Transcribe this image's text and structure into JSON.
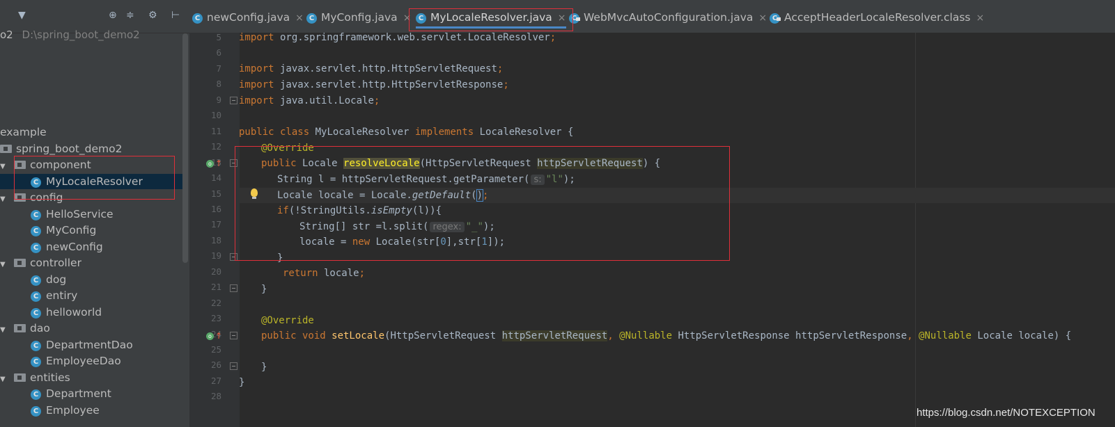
{
  "project": {
    "root_name": "o2",
    "root_path": "D:\\spring_boot_demo2"
  },
  "tree": [
    {
      "label": "example",
      "kind": "text",
      "indent": 0
    },
    {
      "label": "spring_boot_demo2",
      "kind": "folder",
      "indent": 0
    },
    {
      "label": "component",
      "kind": "folder",
      "indent": 1,
      "expanded": true
    },
    {
      "label": "MyLocaleResolver",
      "kind": "class",
      "indent": 2,
      "selected": true
    },
    {
      "label": "config",
      "kind": "folder",
      "indent": 1,
      "expanded": true
    },
    {
      "label": "HelloService",
      "kind": "class",
      "indent": 2
    },
    {
      "label": "MyConfig",
      "kind": "class",
      "indent": 2
    },
    {
      "label": "newConfig",
      "kind": "class",
      "indent": 2
    },
    {
      "label": "controller",
      "kind": "folder",
      "indent": 1,
      "expanded": true
    },
    {
      "label": "dog",
      "kind": "class",
      "indent": 2
    },
    {
      "label": "entiry",
      "kind": "class",
      "indent": 2
    },
    {
      "label": "helloworld",
      "kind": "class",
      "indent": 2
    },
    {
      "label": "dao",
      "kind": "folder",
      "indent": 1,
      "expanded": true
    },
    {
      "label": "DepartmentDao",
      "kind": "class",
      "indent": 2
    },
    {
      "label": "EmployeeDao",
      "kind": "class",
      "indent": 2
    },
    {
      "label": "entities",
      "kind": "folder",
      "indent": 1,
      "expanded": true
    },
    {
      "label": "Department",
      "kind": "class",
      "indent": 2
    },
    {
      "label": "Employee",
      "kind": "class",
      "indent": 2
    }
  ],
  "tabs": [
    {
      "label": "newConfig.java",
      "active": false,
      "locked": false
    },
    {
      "label": "MyConfig.java",
      "active": false,
      "locked": false
    },
    {
      "label": "MyLocaleResolver.java",
      "active": true,
      "locked": false
    },
    {
      "label": "WebMvcAutoConfiguration.java",
      "active": false,
      "locked": true
    },
    {
      "label": "AcceptHeaderLocaleResolver.class",
      "active": false,
      "locked": true
    }
  ],
  "icons": {
    "class": "C",
    "close": "×",
    "arrow_down": "▼",
    "override": "o",
    "up_arrow": "↑"
  },
  "line_numbers": [
    "5",
    "6",
    "7",
    "8",
    "9",
    "10",
    "11",
    "12",
    "13",
    "14",
    "15",
    "16",
    "17",
    "18",
    "19",
    "20",
    "21",
    "22",
    "23",
    "24",
    "25",
    "26",
    "27",
    "28"
  ],
  "code": {
    "l5_kw": "import",
    "l5_rest": " org.springframework.web.servlet.LocaleResolver",
    "l7_kw": "import",
    "l7_rest": " javax.servlet.http.HttpServletRequest",
    "l8_kw": "import",
    "l8_rest": " javax.servlet.http.HttpServletResponse",
    "l9_kw": "import",
    "l9_rest": " java.util.Locale",
    "semicolon": ";",
    "l11_public": "public class",
    "l11_name": " MyLocaleResolver ",
    "l11_impl": "implements",
    "l11_rest": " LocaleResolver {",
    "override": "@Override",
    "l13_public": "public",
    "l13_type": " Locale ",
    "l13_method": "resolveLocale",
    "l13_paren": "(HttpServletRequest ",
    "l13_param": "httpServletRequest",
    "l13_end": ") {",
    "l14_a": "String l = httpServletRequest.getParameter(",
    "l14_hint": "s:",
    "l14_str": "\"l\"",
    "l14_end": ");",
    "l15_a": "Locale locale = Locale.",
    "l15_call": "getDefault",
    "l15_p1": "(",
    "l15_p2": ")",
    "l16_kw": "if",
    "l16_a": "(!StringUtils.",
    "l16_call": "isEmpty",
    "l16_end": "(l)){",
    "l17_a": "String[] str =l.split(",
    "l17_hint": "regex:",
    "l17_str": "\"_\"",
    "l17_end": ");",
    "l18_a": "locale = ",
    "l18_kw": "new",
    "l18_b": " Locale(str[",
    "l18_n0": "0",
    "l18_c": "],str[",
    "l18_n1": "1",
    "l18_end": "]);",
    "close_brace": "}",
    "l20_kw": "return",
    "l20_rest": " locale",
    "l24_public": "public void",
    "l24_method": " setLocale",
    "l24_a": "(HttpServletRequest ",
    "l24_param": "httpServletRequest",
    "l24_comma": ", ",
    "nullable": "@Nullable",
    "l24_b": " HttpServletResponse httpServletResponse",
    "l24_c": " Locale locale) {"
  },
  "watermark": "https://blog.csdn.net/NOTEXCEPTION"
}
